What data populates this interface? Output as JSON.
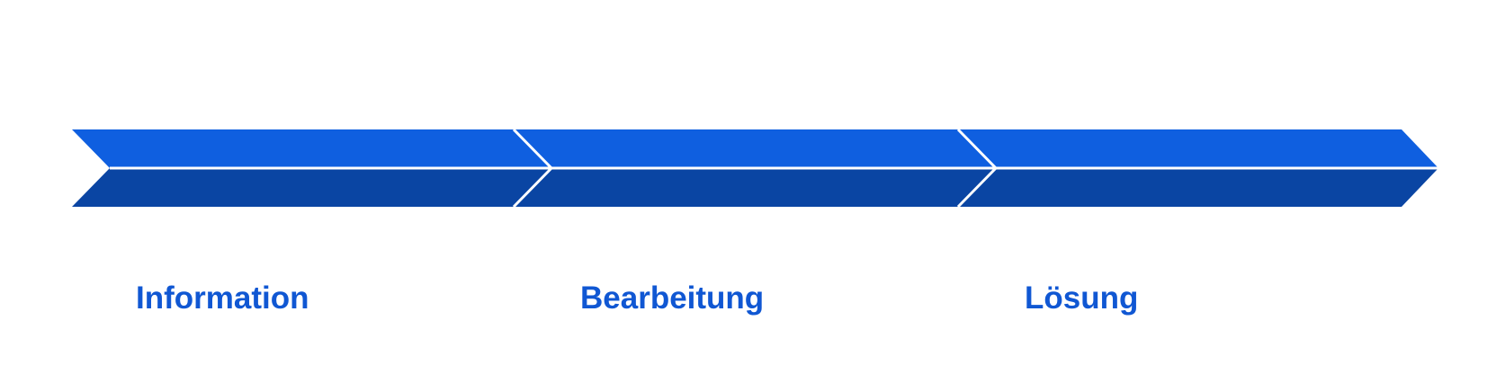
{
  "colors": {
    "upper": "#0f5fe0",
    "lower": "#0a45a3",
    "separator": "#ffffff",
    "label": "#1057d3"
  },
  "steps": [
    {
      "label": "Information"
    },
    {
      "label": "Bearbeitung"
    },
    {
      "label": "Lösung"
    }
  ]
}
